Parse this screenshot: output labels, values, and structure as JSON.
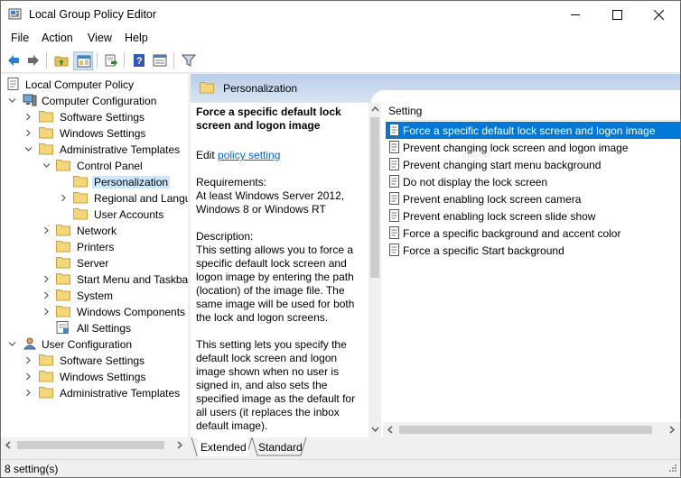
{
  "window": {
    "title": "Local Group Policy Editor",
    "controls": [
      "minimize",
      "maximize",
      "close"
    ]
  },
  "menu": [
    "File",
    "Action",
    "View",
    "Help"
  ],
  "toolbar": {
    "icons": [
      "back-icon",
      "forward-icon",
      "up-folder-icon",
      "show-hide-tree-icon",
      "export-list-icon",
      "help-icon",
      "properties-icon",
      "filter-icon"
    ]
  },
  "tree": {
    "root": "Local Computer Policy",
    "computer_config": "Computer Configuration",
    "cc_software": "Software Settings",
    "cc_windows": "Windows Settings",
    "cc_admin": "Administrative Templates",
    "control_panel": "Control Panel",
    "personalization": "Personalization",
    "regional": "Regional and Langu",
    "user_accounts": "User Accounts",
    "network": "Network",
    "printers": "Printers",
    "server": "Server",
    "start_menu": "Start Menu and Taskba",
    "system": "System",
    "windows_components": "Windows Components",
    "all_settings": "All Settings",
    "user_config": "User Configuration",
    "uc_software": "Software Settings",
    "uc_windows": "Windows Settings",
    "uc_admin": "Administrative Templates"
  },
  "header": {
    "title": "Personalization"
  },
  "description": {
    "title": "Force a specific default lock screen and logon image",
    "edit_prefix": "Edit",
    "edit_link": "policy setting",
    "requirements_label": "Requirements:",
    "requirements_line1": "At least Windows Server 2012,",
    "requirements_line2": "Windows 8 or Windows RT",
    "description_label": "Description:",
    "para1_lines": [
      "This setting allows you to force a",
      "specific default lock screen and",
      "logon image by entering the path",
      "(location) of the image file. The",
      "same image will be used for both",
      "the lock and logon screens."
    ],
    "para2_lines": [
      "This setting lets you specify the",
      "default lock screen and logon",
      "image shown when no user is",
      "signed in, and also sets the",
      "specified image as the default for",
      "all users (it replaces the inbox",
      "default image)."
    ]
  },
  "list": {
    "column": "Setting",
    "items": [
      "Force a specific default lock screen and logon image",
      "Prevent changing lock screen and logon image",
      "Prevent changing start menu background",
      "Do not display the lock screen",
      "Prevent enabling lock screen camera",
      "Prevent enabling lock screen slide show",
      "Force a specific background and accent color",
      "Force a specific Start background"
    ],
    "selected_index": 0
  },
  "tabs": [
    "Extended",
    "Standard"
  ],
  "status": {
    "text": "8 setting(s)"
  }
}
